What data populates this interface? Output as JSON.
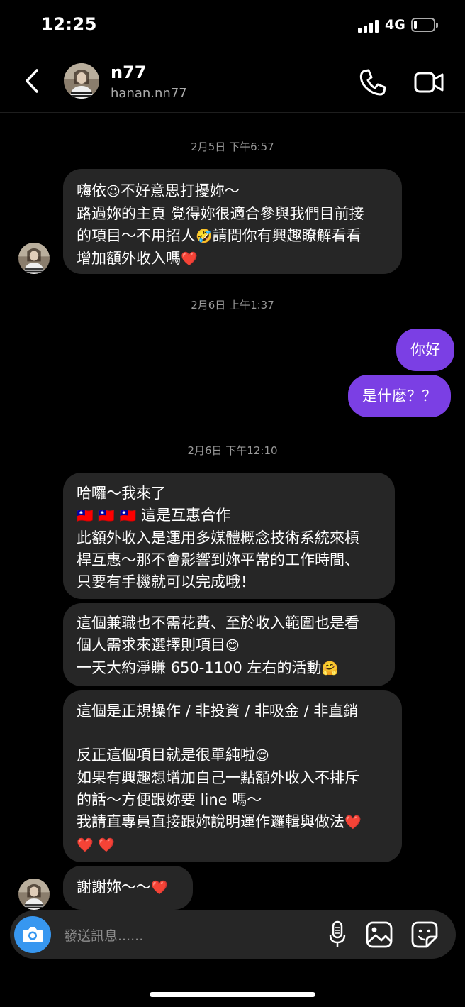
{
  "status_bar": {
    "time": "12:25",
    "network": "4G",
    "battery_level": 0.15
  },
  "header": {
    "name": "n77",
    "handle": "hanan.nn77"
  },
  "timestamps": [
    "2月5日 下午6:57",
    "2月6日 上午1:37",
    "2月6日 下午12:10"
  ],
  "messages": {
    "m1": {
      "lines": [
        "嗨依",
        "不好意思打擾妳～",
        "路過妳的主頁 覺得妳很適合參與我們目前接",
        "的項目～不用招人",
        "請問你有興趣瞭解看看",
        "增加額外收入嗎"
      ],
      "emojis": [
        "😉",
        "🤣",
        "❤️"
      ]
    },
    "s1": "你好",
    "s2": "是什麼？？",
    "m2": {
      "lines": [
        "哈囉～我來了",
        "這是互惠合作",
        "此額外收入是運用多媒體概念技術系統來槓",
        "桿互惠～那不會影響到妳平常的工作時間、",
        "只要有手機就可以完成哦！"
      ],
      "emojis": [
        "🇹🇼",
        "🇹🇼",
        "🇹🇼"
      ]
    },
    "m3": {
      "lines": [
        "這個兼職也不需花費、至於收入範圍也是看",
        "個人需求來選擇則項目",
        "一天大約淨賺 650-1100 左右的活動"
      ],
      "emojis": [
        "😊",
        "🤗"
      ]
    },
    "m4": {
      "lines": [
        "這個是正規操作 / 非投資 / 非吸金 / 非直銷",
        "反正這個項目就是很單純啦",
        "如果有興趣想增加自己一點額外收入不排斥",
        "的話～方便跟妳要 line 嗎～",
        "我請直專員直接跟妳說明運作邏輯與做法"
      ],
      "emojis": [
        "😌",
        "❤️",
        "❤️",
        "❤️"
      ]
    },
    "m5": {
      "text": "謝謝妳～～",
      "emoji": "❤️"
    }
  },
  "compose": {
    "placeholder": "發送訊息......"
  },
  "icons": {
    "back": "chevron-left-icon",
    "call": "phone-icon",
    "video": "video-camera-icon",
    "camera": "camera-icon",
    "mic": "microphone-icon",
    "gallery": "gallery-icon",
    "sticker": "sticker-icon"
  },
  "colors": {
    "sent_bubble": "#7b3fe4",
    "received_bubble": "#262626",
    "camera_button": "#3797f0",
    "background": "#000000"
  }
}
